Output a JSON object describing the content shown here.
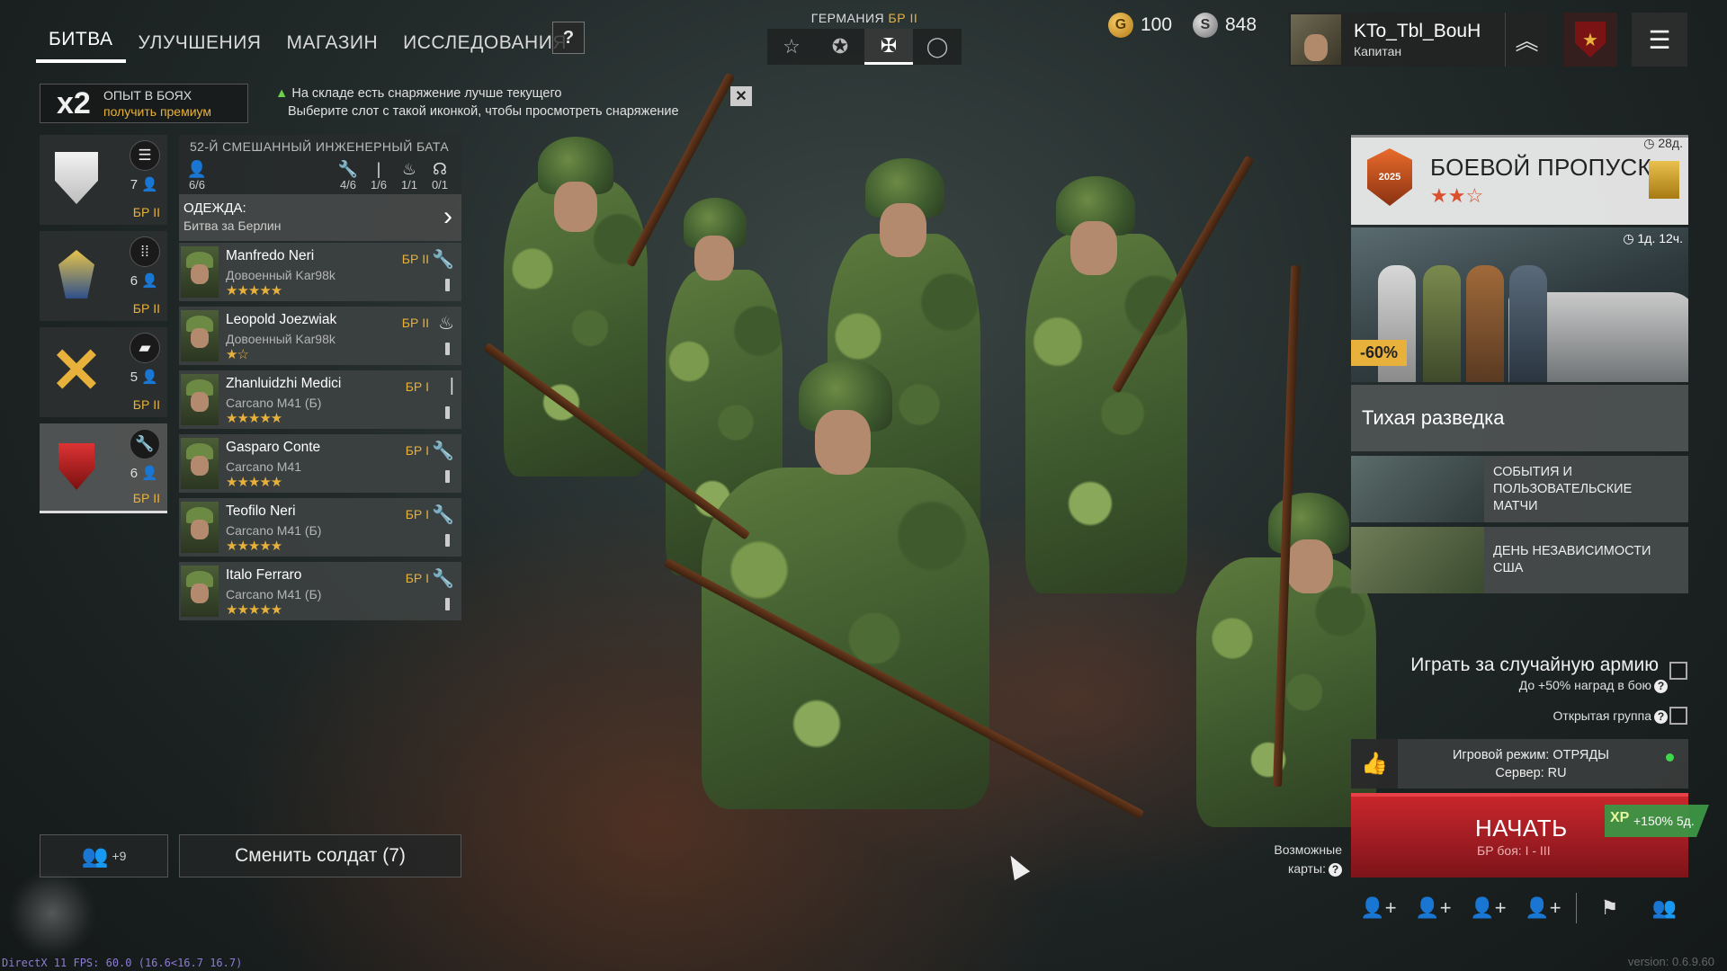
{
  "nav": {
    "tabs": [
      {
        "label": "БИТВА",
        "active": true
      },
      {
        "label": "УЛУЧШЕНИЯ"
      },
      {
        "label": "МАГАЗИН"
      },
      {
        "label": "ИССЛЕДОВАНИЯ"
      }
    ],
    "help": "?"
  },
  "xp": {
    "multiplier": "x2",
    "line1": "ОПЫТ В БОЯХ",
    "line2": "получить премиум"
  },
  "notice": {
    "line1": "На складе есть снаряжение лучше текущего",
    "line2": "Выберите слот с такой иконкой, чтобы просмотреть снаряжение",
    "close": "✕"
  },
  "nation": {
    "label": "ГЕРМАНИЯ",
    "br": "БР II",
    "tabs": [
      "star-icon",
      "allies-star-icon",
      "german-cross-icon",
      "circle-icon"
    ],
    "active_index": 2
  },
  "currency": {
    "gold": "100",
    "silver": "848"
  },
  "profile": {
    "name": "KTo_Tbl_BouH",
    "rank": "Капитан"
  },
  "squads": [
    {
      "icon": "list-icon",
      "count": "7",
      "br": "БР II",
      "emblem": "white-shield"
    },
    {
      "icon": "ammo-icon",
      "count": "6",
      "br": "БР II",
      "emblem": "eagle"
    },
    {
      "icon": "tank-icon",
      "count": "5",
      "br": "БР II",
      "emblem": "crossed-swords"
    },
    {
      "icon": "wrench-icon",
      "count": "6",
      "br": "БР II",
      "emblem": "red-shield"
    }
  ],
  "battalion": {
    "title": "52-Й СМЕШАННЫЙ ИНЖЕНЕРНЫЙ БАТА",
    "stats": [
      {
        "icon": "soldier-icon",
        "value": "6/6"
      },
      {
        "icon": "wrench-icon",
        "value": "4/6"
      },
      {
        "icon": "rifle-icon",
        "value": "1/6"
      },
      {
        "icon": "flame-icon",
        "value": "1/1"
      },
      {
        "icon": "radio-icon",
        "value": "0/1"
      }
    ],
    "clothing_label": "ОДЕЖДА:",
    "clothing_value": "Битва за Берлин"
  },
  "soldiers": [
    {
      "name": "Manfredo Neri",
      "weapon": "Довоенный Kar98k",
      "stars": "★★★★★",
      "br": "БР II",
      "class": "wrench-icon"
    },
    {
      "name": "Leopold Joezwiak",
      "weapon": "Довоенный Kar98k",
      "stars": "★☆",
      "br": "БР II",
      "class": "flame-icon"
    },
    {
      "name": "Zhanluidzhi Medici",
      "weapon": "Carcano M41 (Б)",
      "stars": "★★★★★",
      "br": "БР I",
      "class": "rifle-icon"
    },
    {
      "name": "Gasparo Conte",
      "weapon": "Carcano M41",
      "stars": "★★★★★",
      "br": "БР I",
      "class": "wrench-icon"
    },
    {
      "name": "Teofilo Neri",
      "weapon": "Carcano M41 (Б)",
      "stars": "★★★★★",
      "br": "БР I",
      "class": "wrench-icon"
    },
    {
      "name": "Italo Ferraro",
      "weapon": "Carcano M41 (Б)",
      "stars": "★★★★★",
      "br": "БР I",
      "class": "wrench-icon"
    }
  ],
  "battle_pass": {
    "title": "БОЕВОЙ ПРОПУСК",
    "stars": "★★☆",
    "days_left": "28д.",
    "emblem_text": "2025",
    "offer_timer": "1д. 12ч.",
    "discount": "-60%",
    "mission": "Тихая разведка"
  },
  "events": [
    {
      "label": "СОБЫТИЯ И ПОЛЬЗОВАТЕЛЬСКИЕ МАТЧИ"
    },
    {
      "label": "ДЕНЬ НЕЗАВИСИМОСТИ США"
    }
  ],
  "options": {
    "random_army": "Играть за случайную армию",
    "random_army_sub": "До +50% наград в бою",
    "open_group": "Открытая группа"
  },
  "mode": {
    "line1": "Игровой режим: ОТРЯДЫ",
    "line2": "Сервер: RU"
  },
  "start": {
    "label": "НАЧАТЬ",
    "sub": "БР боя: I - III",
    "boost": "+150% 5д.",
    "boost_icon": "XP"
  },
  "maps": {
    "label1": "Возможные",
    "label2": "карты:"
  },
  "squad_invite": {
    "count": "+9"
  },
  "change_soldiers": "Сменить солдат (7)",
  "fps": "DirectX 11 FPS: 60.0 (16.6<16.7 16.7)",
  "version": "version: 0.6.9.60",
  "colors": {
    "accent_gold": "#e7b13b",
    "start_red": "#c8262b",
    "online_green": "#3ed84a"
  }
}
